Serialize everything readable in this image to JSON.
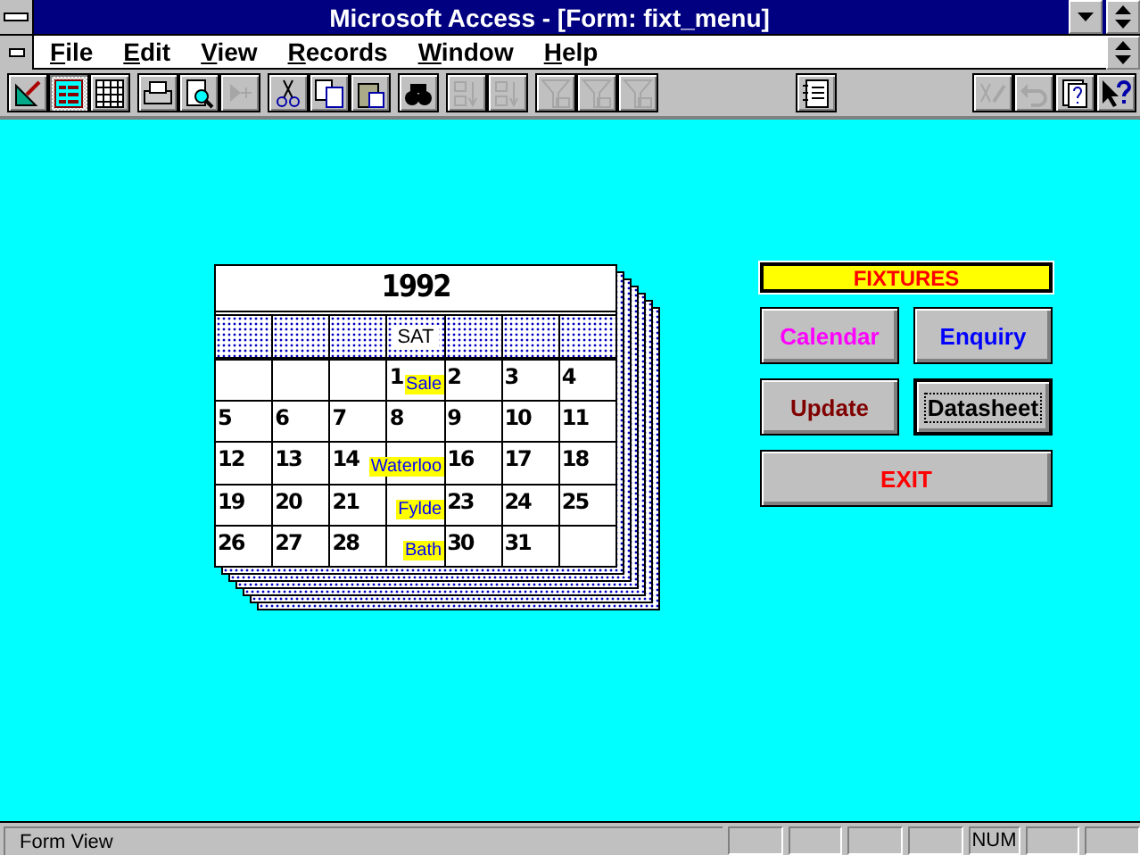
{
  "window": {
    "title": "Microsoft Access - [Form: fixt_menu]"
  },
  "menu": [
    {
      "label": "File"
    },
    {
      "label": "Edit"
    },
    {
      "label": "View"
    },
    {
      "label": "Records"
    },
    {
      "label": "Window"
    },
    {
      "label": "Help"
    }
  ],
  "toolbar": [
    [
      {
        "kind": "design",
        "disabled": false,
        "selected": false
      },
      {
        "kind": "form",
        "disabled": false,
        "selected": true
      },
      {
        "kind": "datasheet",
        "disabled": false,
        "selected": false
      }
    ],
    [
      {
        "kind": "print",
        "disabled": false,
        "selected": false
      },
      {
        "kind": "preview",
        "disabled": false,
        "selected": false
      },
      {
        "kind": "new",
        "disabled": true,
        "selected": false
      }
    ],
    [
      {
        "kind": "cut",
        "disabled": false,
        "selected": false
      },
      {
        "kind": "copy",
        "disabled": false,
        "selected": false
      },
      {
        "kind": "paste",
        "disabled": false,
        "selected": false
      }
    ],
    [
      {
        "kind": "find",
        "disabled": false,
        "selected": false
      }
    ],
    [
      {
        "kind": "sortasc",
        "disabled": true,
        "selected": false
      },
      {
        "kind": "sortdesc",
        "disabled": true,
        "selected": false
      }
    ],
    [
      {
        "kind": "filteredit",
        "disabled": true,
        "selected": false
      },
      {
        "kind": "filter",
        "disabled": true,
        "selected": false
      },
      {
        "kind": "filter",
        "disabled": true,
        "selected": false
      }
    ],
    [
      {
        "kind": "spacer"
      }
    ],
    [
      {
        "kind": "database",
        "disabled": false,
        "selected": false
      }
    ],
    [
      {
        "kind": "spacer"
      }
    ],
    [
      {
        "kind": "undofield",
        "disabled": true,
        "selected": false
      },
      {
        "kind": "undo",
        "disabled": true,
        "selected": false
      },
      {
        "kind": "cuecards",
        "disabled": false,
        "selected": false
      },
      {
        "kind": "help",
        "disabled": false,
        "selected": false
      }
    ]
  ],
  "calendar": {
    "year": "1992",
    "weekday": "SAT",
    "weeks": [
      [
        {
          "kind": "blank"
        },
        {
          "kind": "blank"
        },
        {
          "kind": "blank"
        },
        {
          "kind": "day",
          "day": "1",
          "event": "Sale"
        },
        {
          "kind": "day",
          "day": "2"
        },
        {
          "kind": "day",
          "day": "3"
        },
        {
          "kind": "day",
          "day": "4"
        }
      ],
      [
        {
          "kind": "day",
          "day": "5"
        },
        {
          "kind": "day",
          "day": "6"
        },
        {
          "kind": "day",
          "day": "7"
        },
        {
          "kind": "day",
          "day": "8"
        },
        {
          "kind": "day",
          "day": "9"
        },
        {
          "kind": "day",
          "day": "10"
        },
        {
          "kind": "day",
          "day": "11"
        }
      ],
      [
        {
          "kind": "day",
          "day": "12"
        },
        {
          "kind": "day",
          "day": "13"
        },
        {
          "kind": "day",
          "day": "14"
        },
        {
          "kind": "day",
          "event": "Waterloo"
        },
        {
          "kind": "day",
          "day": "16"
        },
        {
          "kind": "day",
          "day": "17"
        },
        {
          "kind": "day",
          "day": "18"
        }
      ],
      [
        {
          "kind": "day",
          "day": "19"
        },
        {
          "kind": "day",
          "day": "20"
        },
        {
          "kind": "day",
          "day": "21"
        },
        {
          "kind": "day",
          "event": "Fylde"
        },
        {
          "kind": "day",
          "day": "23"
        },
        {
          "kind": "day",
          "day": "24"
        },
        {
          "kind": "day",
          "day": "25"
        }
      ],
      [
        {
          "kind": "day",
          "day": "26"
        },
        {
          "kind": "day",
          "day": "27"
        },
        {
          "kind": "day",
          "day": "28"
        },
        {
          "kind": "day",
          "event": "Bath"
        },
        {
          "kind": "day",
          "day": "30"
        },
        {
          "kind": "day",
          "day": "31"
        },
        {
          "kind": "blank"
        }
      ]
    ]
  },
  "panel": {
    "title": "FIXTURES",
    "buttons": [
      {
        "label": "Calendar",
        "color": "#ff00ff",
        "focused": false
      },
      {
        "label": "Enquiry",
        "color": "#0000ff",
        "focused": false
      },
      {
        "label": "Update",
        "color": "#800000",
        "focused": false
      },
      {
        "label": "Datasheet",
        "color": "#000000",
        "focused": true
      },
      {
        "label": "EXIT",
        "color": "#ff0000",
        "focused": false
      }
    ]
  },
  "status_bar": {
    "message": "Form View",
    "indicator": "NUM"
  }
}
